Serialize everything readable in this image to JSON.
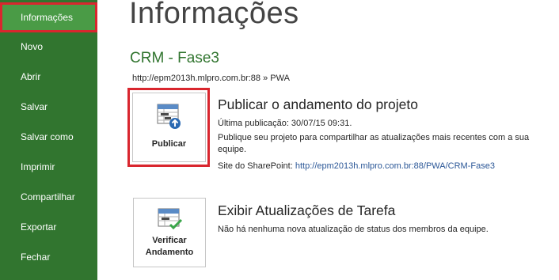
{
  "sidebar": {
    "items": [
      {
        "label": "Informações",
        "active": true
      },
      {
        "label": "Novo"
      },
      {
        "label": "Abrir"
      },
      {
        "label": "Salvar"
      },
      {
        "label": "Salvar como"
      },
      {
        "label": "Imprimir"
      },
      {
        "label": "Compartilhar"
      },
      {
        "label": "Exportar"
      },
      {
        "label": "Fechar"
      }
    ]
  },
  "main": {
    "title": "Informações",
    "project_name": "CRM - Fase3",
    "project_url": "http://epm2013h.mlpro.com.br:88 » PWA",
    "publish": {
      "button_label": "Publicar",
      "icon": "publish-schedule-icon",
      "title": "Publicar o andamento do projeto",
      "last_publish": "Última publicação: 30/07/15 09:31.",
      "description": "Publique seu projeto para compartilhar as atualizações mais recentes com a sua equipe.",
      "site_label": "Site do SharePoint:",
      "site_url": "http://epm2013h.mlpro.com.br:88/PWA/CRM-Fase3"
    },
    "updates": {
      "button_line1": "Verificar",
      "button_line2": "Andamento",
      "icon": "check-progress-icon",
      "title": "Exibir Atualizações de Tarefa",
      "description": "Não há nenhuma nova atualização de status dos membros da equipe."
    }
  },
  "colors": {
    "sidebar_bg": "#31752f",
    "sidebar_active": "#4a9b46",
    "accent_green": "#31752f",
    "highlight_red": "#d9262e",
    "link": "#2b5797"
  }
}
